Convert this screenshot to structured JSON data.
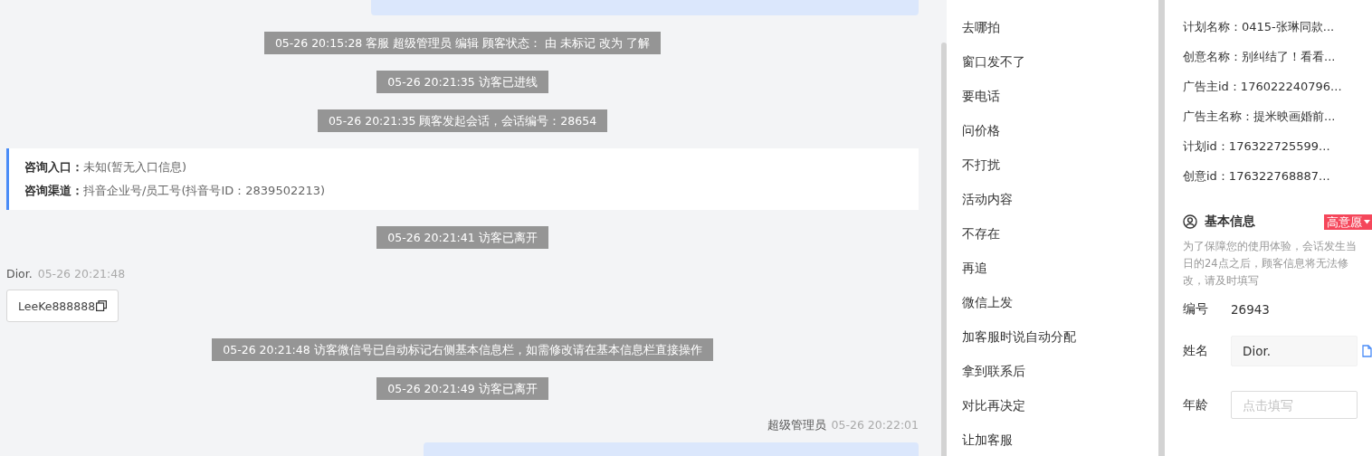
{
  "chat": {
    "messages": [
      {
        "kind": "agent_message"
      },
      {
        "kind": "notice",
        "text": "05-26 20:15:28 客服 超级管理员 编辑 顾客状态： 由 未标记 改为 了解"
      },
      {
        "kind": "notice",
        "text": "05-26 20:21:35 访客已进线"
      },
      {
        "kind": "notice",
        "text": "05-26 20:21:35 顾客发起会话，会话编号：28654"
      },
      {
        "kind": "source_card",
        "rows": [
          {
            "label": "咨询入口：",
            "value": "未知(暂无入口信息)"
          },
          {
            "label": "咨询渠道：",
            "value": "抖音企业号/员工号(抖音号ID：2839502213)"
          }
        ]
      },
      {
        "kind": "notice",
        "text": "05-26 20:21:41 访客已离开"
      },
      {
        "kind": "visitor_message",
        "sender": "Dior.",
        "time": "05-26 20:21:48",
        "text": "LeeKe888888"
      },
      {
        "kind": "notice",
        "text": "05-26 20:21:48 访客微信号已自动标记右侧基本信息栏，如需修改请在基本信息栏直接操作"
      },
      {
        "kind": "notice",
        "text": "05-26 20:21:49 访客已离开"
      },
      {
        "kind": "agent_message",
        "sender": "超级管理员",
        "time": "05-26 20:22:01"
      }
    ]
  },
  "quick_replies": [
    "去哪拍",
    "窗口发不了",
    "要电话",
    "问价格",
    "不打扰",
    "活动内容",
    "不存在",
    "再追",
    "微信上发",
    "加客服时说自动分配",
    "拿到联系后",
    "对比再决定",
    "让加客服"
  ],
  "ad_info": [
    "计划名称：0415-张琳同款...",
    "创意名称：别纠结了！看看...",
    "广告主id：176022240796...",
    "广告主名称：提米映画婚前...",
    "计划id：176322725599...",
    "创意id：176322768887..."
  ],
  "basic_info": {
    "title": "基本信息",
    "badge": "高意愿",
    "note": "为了保障您的使用体验，会话发生当日的24点之后，顾客信息将无法修改，请及时填写",
    "fields": [
      {
        "kind": "text",
        "label": "编号",
        "value": "26943"
      },
      {
        "kind": "readonly_input",
        "label": "姓名",
        "value": "Dior."
      },
      {
        "kind": "input",
        "label": "年龄",
        "placeholder": "点击填写"
      }
    ]
  }
}
